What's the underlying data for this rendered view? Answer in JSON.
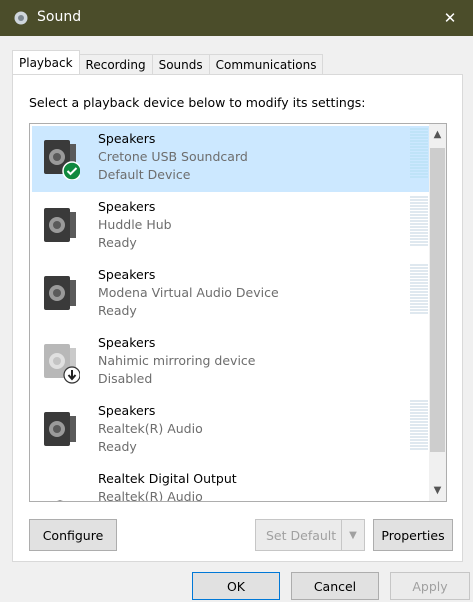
{
  "window": {
    "title": "Sound",
    "close_glyph": "✕"
  },
  "tabs": [
    "Playback",
    "Recording",
    "Sounds",
    "Communications"
  ],
  "instruction": "Select a playback device below to modify its settings:",
  "devices": [
    {
      "name": "Speakers",
      "device": "Cretone USB Soundcard",
      "status": "Default Device",
      "selected": true,
      "badge": "green-check-icon"
    },
    {
      "name": "Speakers",
      "device": "Huddle Hub",
      "status": "Ready"
    },
    {
      "name": "Speakers",
      "device": "Modena Virtual Audio Device",
      "status": "Ready"
    },
    {
      "name": "Speakers",
      "device": "Nahimic mirroring device",
      "status": "Disabled",
      "badge": "disabled-arrow-icon"
    },
    {
      "name": "Speakers",
      "device": "Realtek(R) Audio",
      "status": "Ready"
    },
    {
      "name": "Realtek Digital Output",
      "device": "Realtek(R) Audio",
      "status": ""
    }
  ],
  "buttons": {
    "configure": "Configure",
    "set_default": "Set Default",
    "properties": "Properties",
    "ok": "OK",
    "cancel": "Cancel",
    "apply": "Apply"
  },
  "colors": {
    "titlebar": "#4b4d2a",
    "selection": "#cce8ff",
    "accent": "#0078d7"
  }
}
